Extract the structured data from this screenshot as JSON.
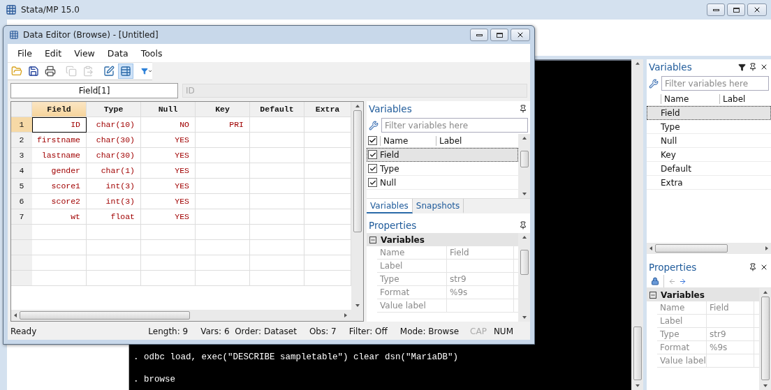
{
  "main_window": {
    "title": "Stata/MP 15.0"
  },
  "results": {
    "lines": [
      ". odbc load, exec(\"DESCRIBE sampletable\") clear dsn(\"MariaDB\")",
      ". browse"
    ]
  },
  "variables_panel": {
    "title": "Variables",
    "filter_placeholder": "Filter variables here",
    "columns": [
      "Name",
      "Label"
    ],
    "rows": [
      {
        "name": "Field",
        "selected": true
      },
      {
        "name": "Type",
        "selected": false
      },
      {
        "name": "Null",
        "selected": false
      },
      {
        "name": "Key",
        "selected": false
      },
      {
        "name": "Default",
        "selected": false
      },
      {
        "name": "Extra",
        "selected": false
      }
    ]
  },
  "properties_panel": {
    "title": "Properties",
    "section": "Variables",
    "rows": [
      {
        "label": "Name",
        "value": "Field"
      },
      {
        "label": "Label"
      },
      {
        "label": "Type",
        "value": "str9"
      },
      {
        "label": "Format",
        "value": "%9s"
      },
      {
        "label": "Value label"
      }
    ]
  },
  "data_editor": {
    "title": "Data Editor (Browse) - [Untitled]",
    "menu": [
      "File",
      "Edit",
      "View",
      "Data",
      "Tools"
    ],
    "toolbar": [
      {
        "kind": "open",
        "disabled": false,
        "selected": false
      },
      {
        "kind": "save",
        "disabled": false,
        "selected": false
      },
      {
        "kind": "print",
        "disabled": false,
        "selected": false
      },
      {
        "kind": "copy",
        "disabled": true,
        "selected": false
      },
      {
        "kind": "paste",
        "disabled": true,
        "selected": false
      },
      {
        "kind": "edit",
        "disabled": false,
        "selected": false
      },
      {
        "kind": "browse",
        "disabled": false,
        "selected": true
      },
      {
        "kind": "filter",
        "disabled": false,
        "selected": false
      }
    ],
    "cell_ref": "Field[1]",
    "cell_value": "ID",
    "table": {
      "columns": [
        {
          "label": "Field",
          "selected": true
        },
        {
          "label": "Type",
          "selected": false
        },
        {
          "label": "Null",
          "selected": false
        },
        {
          "label": "Key",
          "selected": false
        },
        {
          "label": "Default",
          "selected": false
        },
        {
          "label": "Extra",
          "selected": false
        }
      ],
      "rows": [
        {
          "number": "1",
          "selected": true,
          "cells": [
            "ID",
            "char(10)",
            "NO",
            "PRI"
          ]
        },
        {
          "number": "2",
          "selected": false,
          "cells": [
            "firstname",
            "char(30)",
            "YES"
          ]
        },
        {
          "number": "3",
          "selected": false,
          "cells": [
            "lastname",
            "char(30)",
            "YES"
          ]
        },
        {
          "number": "4",
          "selected": false,
          "cells": [
            "gender",
            "char(1)",
            "YES"
          ]
        },
        {
          "number": "5",
          "selected": false,
          "cells": [
            "score1",
            "int(3)",
            "YES"
          ]
        },
        {
          "number": "6",
          "selected": false,
          "cells": [
            "score2",
            "int(3)",
            "YES"
          ]
        },
        {
          "number": "7",
          "selected": false,
          "cells": [
            "wt",
            "float",
            "YES"
          ]
        }
      ]
    },
    "variables": {
      "title": "Variables",
      "filter_placeholder": "Filter variables here",
      "all_checked": true,
      "columns": [
        "Name",
        "Label"
      ],
      "rows": [
        {
          "name": "Field",
          "checked": true,
          "selected": true
        },
        {
          "name": "Type",
          "checked": true,
          "selected": false
        },
        {
          "name": "Null",
          "checked": true,
          "selected": false
        }
      ],
      "tabs": [
        {
          "label": "Variables",
          "selected": true
        },
        {
          "label": "Snapshots",
          "selected": false
        }
      ]
    },
    "properties": {
      "title": "Properties",
      "section": "Variables",
      "rows": [
        {
          "label": "Name",
          "value": "Field"
        },
        {
          "label": "Label"
        },
        {
          "label": "Type",
          "value": "str9"
        },
        {
          "label": "Format",
          "value": "%9s"
        },
        {
          "label": "Value label"
        }
      ]
    },
    "status": {
      "message": "Ready",
      "items": [
        "Length: 9",
        "Vars: 6  Order: Dataset",
        "Obs: 7",
        "Filter: Off",
        "Mode: Browse"
      ],
      "indicators": [
        {
          "label": "CAP",
          "on": false
        },
        {
          "label": "NUM",
          "on": true
        }
      ]
    }
  }
}
